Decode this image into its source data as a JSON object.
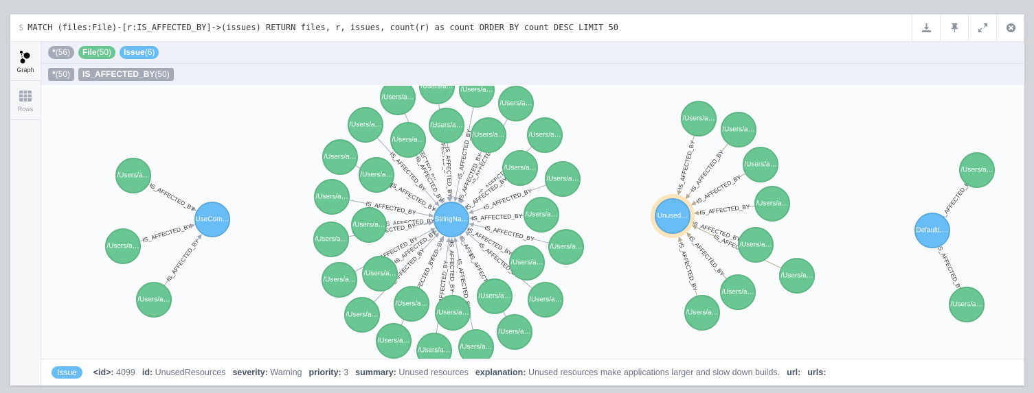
{
  "query": {
    "prompt": "$",
    "text": "MATCH (files:File)-[r:IS_AFFECTED_BY]->(issues) RETURN files, r, issues, count(r) as count ORDER BY count DESC LIMIT 50"
  },
  "actions": [
    {
      "name": "download-icon",
      "label": "Download"
    },
    {
      "name": "pin-icon",
      "label": "Pin"
    },
    {
      "name": "expand-icon",
      "label": "Expand"
    },
    {
      "name": "close-icon",
      "label": "Close"
    }
  ],
  "sidebar": {
    "graph_label": "Graph",
    "rows_label": "Rows"
  },
  "legend": {
    "labels": [
      {
        "name": "*",
        "count": "(56)",
        "color": "#a5abb6"
      },
      {
        "name": "File",
        "count": "(50)",
        "color": "#6ac794"
      },
      {
        "name": "Issue",
        "count": "(6)",
        "color": "#68bdf6"
      }
    ],
    "relationships": [
      {
        "name": "*",
        "count": "(50)"
      },
      {
        "name": "IS_AFFECTED_BY",
        "count": "(50)"
      }
    ]
  },
  "colors": {
    "file_node": "#6ac794",
    "file_stroke": "#5db583",
    "issue_node": "#68bdf6",
    "issue_stroke": "#5ca8db",
    "selected_halo": "#fbe5bd",
    "edge": "#a5abb6"
  },
  "graph": {
    "relationship_label": "IS_AFFECTED_BY",
    "file_label": "/Users/a…",
    "issues": [
      {
        "id": "usecom",
        "label": "UseCom…",
        "selected": false
      },
      {
        "id": "stringna",
        "label": "StringNa…",
        "selected": false
      },
      {
        "id": "unused",
        "label": "Unused…",
        "selected": true
      },
      {
        "id": "defaultl",
        "label": "DefaultL…",
        "selected": false
      }
    ]
  },
  "status": {
    "badge": "Issue",
    "properties": [
      {
        "key": "<id>:",
        "value": "4099"
      },
      {
        "key": "id:",
        "value": "UnusedResources"
      },
      {
        "key": "severity:",
        "value": "Warning"
      },
      {
        "key": "priority:",
        "value": "3"
      },
      {
        "key": "summary:",
        "value": "Unused resources"
      },
      {
        "key": "explanation:",
        "value": "Unused resources make applications larger and slow down builds."
      },
      {
        "key": "url:",
        "value": ""
      },
      {
        "key": "urls:",
        "value": ""
      }
    ]
  }
}
